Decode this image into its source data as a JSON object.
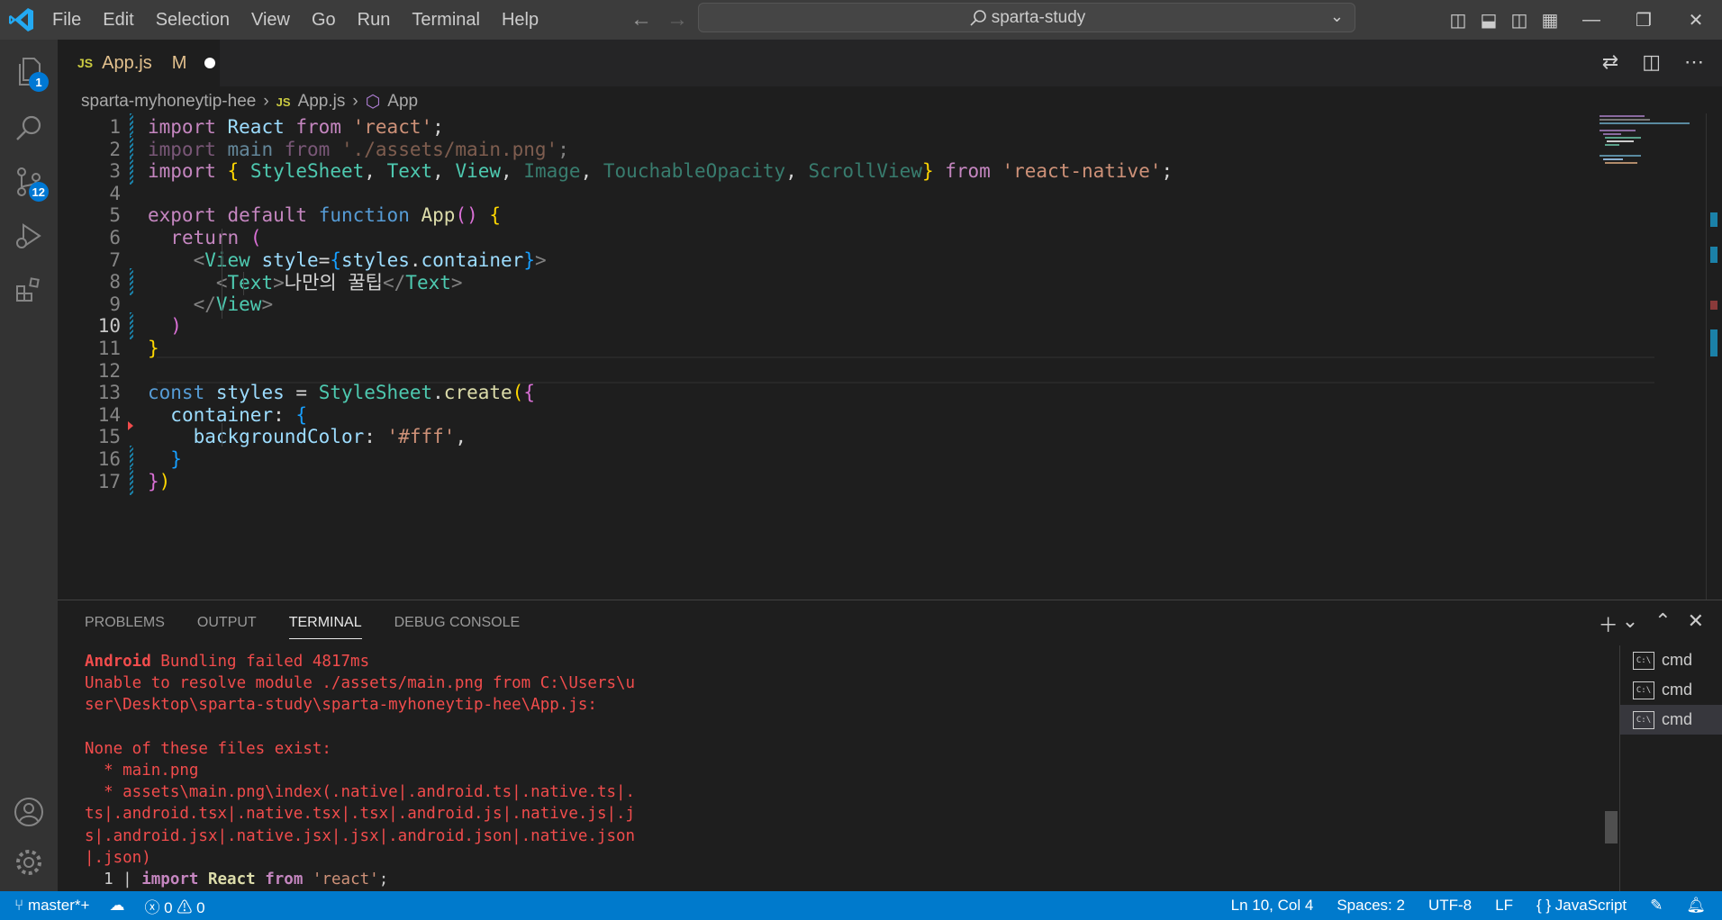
{
  "menu": [
    "File",
    "Edit",
    "Selection",
    "View",
    "Go",
    "Run",
    "Terminal",
    "Help"
  ],
  "search": {
    "label": "sparta-study"
  },
  "activity": {
    "explorer_badge": "1",
    "scm_badge": "12"
  },
  "tab": {
    "lang": "JS",
    "name": "App.js",
    "status": "M"
  },
  "breadcrumb": {
    "folder": "sparta-myhoneytip-hee",
    "lang": "JS",
    "file": "App.js",
    "symbol": "App"
  },
  "editor": {
    "line_numbers": [
      "1",
      "2",
      "3",
      "4",
      "5",
      "6",
      "7",
      "8",
      "9",
      "10",
      "11",
      "12",
      "13",
      "14",
      "15",
      "16",
      "17"
    ],
    "tokens": {
      "import": "import",
      "from": "from",
      "React": "React",
      "react": "'react'",
      "main": "main",
      "mainpath": "'./assets/main.png'",
      "StyleSheet": "StyleSheet",
      "Text": "Text",
      "View": "View",
      "Image": "Image",
      "TouchableOpacity": "TouchableOpacity",
      "ScrollView": "ScrollView",
      "rn": "'react-native'",
      "export": "export",
      "default": "default",
      "function": "function",
      "App": "App",
      "return": "return",
      "style": "style",
      "styles": "styles",
      "container": "container",
      "korean": "나만의 꿀팁",
      "const": "const",
      "create": "create",
      "backgroundColor": "backgroundColor",
      "fff": "'#fff'"
    }
  },
  "panel": {
    "tabs": [
      "PROBLEMS",
      "OUTPUT",
      "TERMINAL",
      "DEBUG CONSOLE"
    ],
    "active": "TERMINAL"
  },
  "terminal": {
    "lines": [
      {
        "a": "Android",
        "b": " Bundling failed ",
        "c": "4817ms"
      },
      "Unable to resolve module ./assets/main.png from C:\\Users\\u",
      "ser\\Desktop\\sparta-study\\sparta-myhoneytip-hee\\App.js:",
      "",
      "None of these files exist:",
      "  * main.png",
      "  * assets\\main.png\\index(.native|.android.ts|.native.ts|.",
      "ts|.android.tsx|.native.tsx|.tsx|.android.js|.native.js|.j",
      "s|.android.jsx|.native.jsx|.jsx|.android.json|.native.json",
      "|.json)"
    ],
    "snippet": {
      "num": "  1 | ",
      "import": "import",
      "react": "React",
      "from": "from",
      "mod": "'react'"
    },
    "instances": [
      "cmd",
      "cmd",
      "cmd"
    ]
  },
  "status": {
    "branch": "master*+",
    "errors": "0",
    "warnings": "0",
    "position": "Ln 10, Col 4",
    "spaces": "Spaces: 2",
    "encoding": "UTF-8",
    "eol": "LF",
    "language": "JavaScript"
  }
}
